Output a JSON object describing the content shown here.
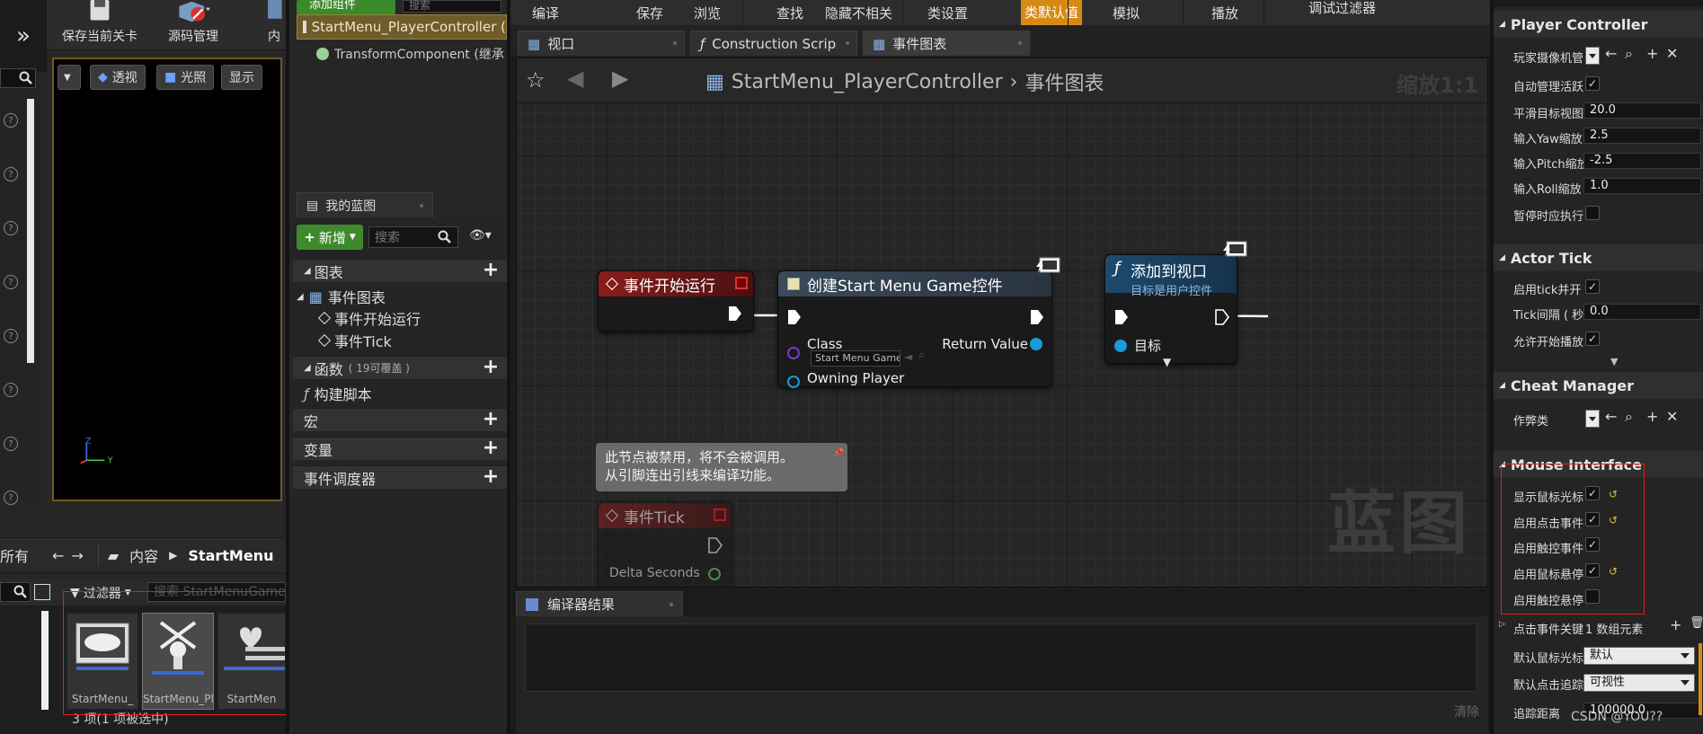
{
  "left_panel": {
    "toolbar": {
      "save_level": "保存当前关卡",
      "source_control": "源码管理",
      "content_truncated": "内"
    },
    "viewport": {
      "perspective": "透视",
      "lit": "光照",
      "show": "显示",
      "axis_z": "Z",
      "axis_y": "Y"
    },
    "content_browser": {
      "all": "所有",
      "content": "内容",
      "folder": "StartMenu",
      "filter": "过滤器",
      "search_placeholder": "搜索 StartMenuGame",
      "assets": [
        {
          "name": "StartMenu_",
          "icon": "gamepad-icon"
        },
        {
          "name": "StartMenu_Player",
          "icon": "pawn-icon"
        },
        {
          "name": "StartMen",
          "icon": "heart-widget-icon"
        }
      ],
      "count": "3 项(1 项被选中)"
    }
  },
  "components": {
    "add_component": "添加组件",
    "search": "搜索",
    "root": "StartMenu_PlayerController (",
    "child": "TransformComponent (继承"
  },
  "my_blueprint": {
    "tab": "我的蓝图",
    "new_button": "新增",
    "search_placeholder": "搜索",
    "categories": {
      "graphs": "图表",
      "event_graph": "事件图表",
      "begin_play": "事件开始运行",
      "tick": "事件Tick",
      "functions": "函数",
      "functions_note": "( 19可覆盖 )",
      "construction_script": "构建脚本",
      "macros": "宏",
      "variables": "变量",
      "event_dispatchers": "事件调度器"
    }
  },
  "main_toolbar": {
    "items": [
      "编译",
      "保存",
      "浏览",
      "查找",
      "隐藏不相关",
      "类设置",
      "类默认值",
      "模拟",
      "播放",
      "调试过滤器"
    ],
    "active": "类默认值"
  },
  "editor_tabs": [
    {
      "label": "视口",
      "icon": "grid-icon"
    },
    {
      "label": "Construction Scrip",
      "icon": "function-icon"
    },
    {
      "label": "事件图表",
      "icon": "grid-icon",
      "active": true
    }
  ],
  "graph": {
    "breadcrumb_root": "StartMenu_PlayerController",
    "breadcrumb_leaf": "事件图表",
    "zoom": "缩放1:1",
    "watermark": "蓝图",
    "nodes": {
      "begin_play": {
        "title": "事件开始运行"
      },
      "create_widget": {
        "title": "创建Start Menu Game控件",
        "class_label": "Class",
        "class_value": "Start Menu Game",
        "owning_player": "Owning Player",
        "return_value": "Return Value"
      },
      "add_to_viewport": {
        "title": "添加到视口",
        "subtitle": "目标是用户控件",
        "target": "目标"
      },
      "tick": {
        "title": "事件Tick",
        "delta": "Delta Seconds"
      }
    },
    "disabled_note": {
      "line1": "此节点被禁用，将不会被调用。",
      "line2": "从引脚连出引线来编译功能。"
    },
    "colors": {
      "event_head": "#8a1c1c",
      "function_head": "#1e4a6e",
      "exec_wire": "#ffffff",
      "object_wire": "#1a9ad6",
      "class_pin": "#5a2a9a"
    }
  },
  "compiler": {
    "tab": "编译器结果",
    "clear": "清除"
  },
  "details": {
    "player_controller": {
      "title": "Player Controller",
      "props": [
        {
          "label": "玩家摄像机管",
          "type": "dropdown"
        },
        {
          "label": "自动管理活跃",
          "type": "check",
          "checked": true
        },
        {
          "label": "平滑目标视图",
          "type": "number",
          "value": "20.0"
        },
        {
          "label": "输入Yaw缩放",
          "type": "number",
          "value": "2.5"
        },
        {
          "label": "输入Pitch缩放",
          "type": "number",
          "value": "-2.5"
        },
        {
          "label": "输入Roll缩放",
          "type": "number",
          "value": "1.0"
        },
        {
          "label": "暂停时应执行",
          "type": "check",
          "checked": false
        }
      ]
    },
    "actor_tick": {
      "title": "Actor Tick",
      "props": [
        {
          "label": "启用tick并开",
          "type": "check",
          "checked": true
        },
        {
          "label": "Tick间隔 ( 秒",
          "type": "number",
          "value": "0.0"
        },
        {
          "label": "允许开始播放",
          "type": "check",
          "checked": true
        }
      ]
    },
    "cheat_manager": {
      "title": "Cheat Manager",
      "props": [
        {
          "label": "作弊类",
          "type": "dropdown"
        }
      ]
    },
    "mouse_interface": {
      "title": "Mouse Interface",
      "props": [
        {
          "label": "显示鼠标光标",
          "checked": true,
          "reset": true
        },
        {
          "label": "启用点击事件",
          "checked": true,
          "reset": true
        },
        {
          "label": "启用触控事件",
          "checked": true,
          "reset": false
        },
        {
          "label": "启用鼠标悬停",
          "checked": true,
          "reset": true
        },
        {
          "label": "启用触控悬停",
          "checked": false,
          "reset": false
        }
      ]
    },
    "click_keys": {
      "label": "点击事件关键",
      "value": "1 数组元素"
    },
    "default_cursor": {
      "label": "默认鼠标光标",
      "value": "默认"
    },
    "default_trace": {
      "label": "默认点击追踪",
      "value": "可视性"
    },
    "trace_distance": {
      "label": "追踪距离",
      "value": "100000.0"
    }
  },
  "watermark_text": "CSDN @YOU??"
}
